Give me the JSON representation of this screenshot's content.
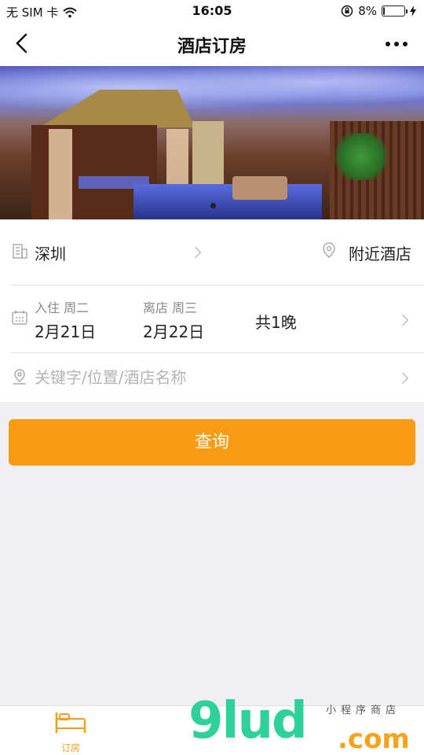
{
  "status_bar": {
    "carrier": "无 SIM 卡",
    "time": "16:05",
    "battery_percent": "8%",
    "battery_level": 0.08
  },
  "nav": {
    "title": "酒店订房",
    "back_icon": "chevron-left-icon",
    "more_icon": "more-dots-icon"
  },
  "banner": {
    "image_subject": "hotel courtyard with thatched hut bar and pool",
    "page_indicator_active": 1
  },
  "location": {
    "city": "深圳",
    "nearby_label": "附近酒店",
    "city_icon": "building-icon",
    "nearby_icon": "location-pin-icon"
  },
  "dates": {
    "checkin_label": "入住 周二",
    "checkin_date": "2月21日",
    "checkout_label": "离店 周三",
    "checkout_date": "2月22日",
    "nights": "共1晚",
    "icon": "calendar-icon"
  },
  "search": {
    "placeholder": "关键字/位置/酒店名称",
    "value": "",
    "icon": "map-pin-icon"
  },
  "query_button": {
    "label": "查询"
  },
  "tabs": [
    {
      "label": "订房",
      "icon": "bed-icon",
      "active": true
    }
  ],
  "watermark": {
    "text_main": "9lud",
    "text_com": ".com",
    "text_small": "小程序商店"
  },
  "colors": {
    "accent": "#f99c14",
    "background": "#efeff4",
    "watermark_green": "#2fd19a",
    "watermark_orange": "#f7a21b"
  }
}
